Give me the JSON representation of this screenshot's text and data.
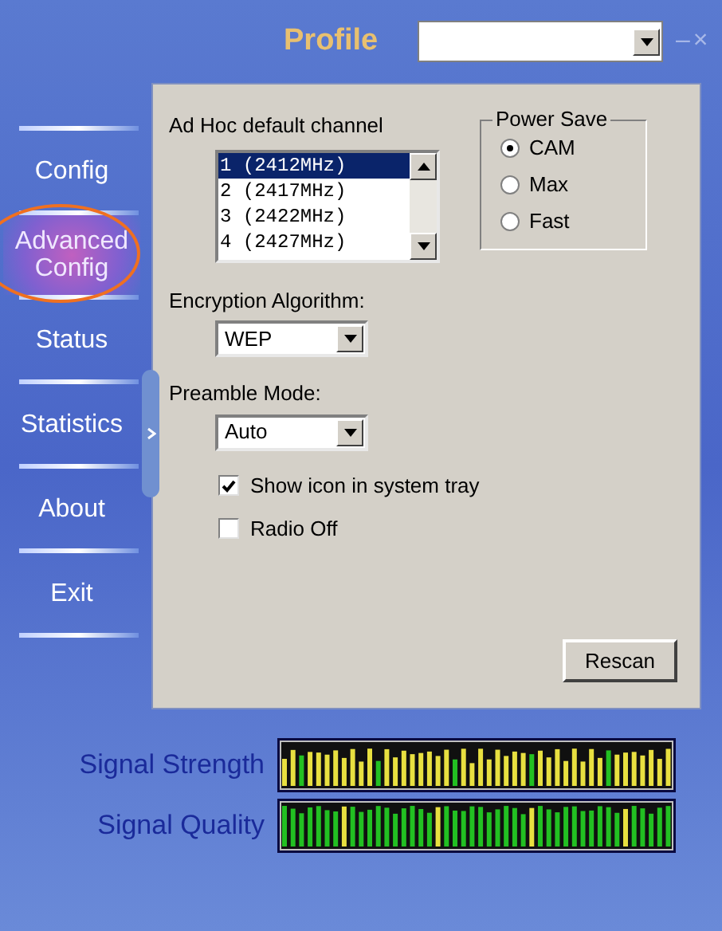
{
  "window": {
    "title": "Profile",
    "minimize": "–",
    "close": "×"
  },
  "sidebar": {
    "items": [
      {
        "label": "Config",
        "selected": false
      },
      {
        "label": "Advanced Config",
        "selected": true
      },
      {
        "label": "Status",
        "selected": false
      },
      {
        "label": "Statistics",
        "selected": false
      },
      {
        "label": "About",
        "selected": false
      },
      {
        "label": "Exit",
        "selected": false
      }
    ]
  },
  "channel": {
    "label": "Ad Hoc default channel",
    "options": [
      {
        "label": "1 (2412MHz)",
        "selected": true
      },
      {
        "label": "2 (2417MHz)",
        "selected": false
      },
      {
        "label": "3 (2422MHz)",
        "selected": false
      },
      {
        "label": "4 (2427MHz)",
        "selected": false
      }
    ]
  },
  "power_save": {
    "label": "Power Save",
    "options": [
      {
        "label": "CAM",
        "selected": true
      },
      {
        "label": "Max",
        "selected": false
      },
      {
        "label": "Fast",
        "selected": false
      }
    ]
  },
  "encryption": {
    "label": "Encryption Algorithm:",
    "value": "WEP"
  },
  "preamble": {
    "label": "Preamble Mode:",
    "value": "Auto"
  },
  "checkboxes": [
    {
      "label": "Show icon in system tray",
      "checked": true
    },
    {
      "label": "Radio Off",
      "checked": false
    }
  ],
  "rescan_button": "Rescan",
  "meters": [
    {
      "label": "Signal Strength"
    },
    {
      "label": "Signal Quality"
    }
  ]
}
